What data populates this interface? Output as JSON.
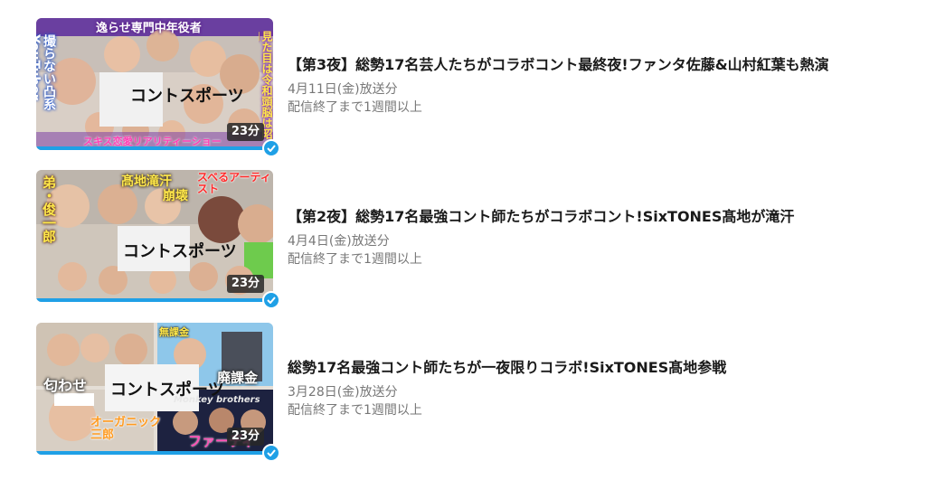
{
  "episodes": [
    {
      "title": "【第3夜】総勢17名芸人たちがコラボコント最終夜!ファンタ佐藤&山村紅葉も熱演",
      "air_date": "4月11日(金)放送分",
      "availability": "配信終了まで1週間以上",
      "duration": "23分",
      "progress": 1.0,
      "watched": true,
      "thumb_text": {
        "top_banner": "逸らせ専門中年役者",
        "left_vertical": "撮らない凸系YouTuber",
        "right_vertical": "見た目は令和頭脳は昭和",
        "logo": "コントスポーツ",
        "bottom": "スキス恋愛リアリティーショー"
      }
    },
    {
      "title": "【第2夜】総勢17名最強コント師たちがコラボコント!SixTONES髙地が滝汗",
      "air_date": "4月4日(金)放送分",
      "availability": "配信終了まで1週間以上",
      "duration": "23分",
      "progress": 1.0,
      "watched": true,
      "thumb_text": {
        "left_vertical": "弟・俊一郎",
        "top_center": "髙地滝汗",
        "collapse": "崩壊",
        "right_top": "スベるアーティスト",
        "logo": "コントスポーツ"
      }
    },
    {
      "title": "総勢17名最強コント師たちが一夜限りコラボ!SixTONES髙地参戦",
      "air_date": "3月28日(金)放送分",
      "availability": "配信終了まで1週間以上",
      "duration": "23分",
      "progress": 1.0,
      "watched": true,
      "thumb_text": {
        "left_middle": "匂わせ",
        "top_right_small": "無課金",
        "heavy": "廃課金",
        "bottom_left": "オーガニック三郎",
        "band": "Monkey brothers",
        "bottom_right": "ファーディ",
        "logo": "コントスポーツ"
      }
    }
  ],
  "colors": {
    "progress": "#1fa0e6",
    "title": "#1a1a1a",
    "meta": "#777777"
  }
}
